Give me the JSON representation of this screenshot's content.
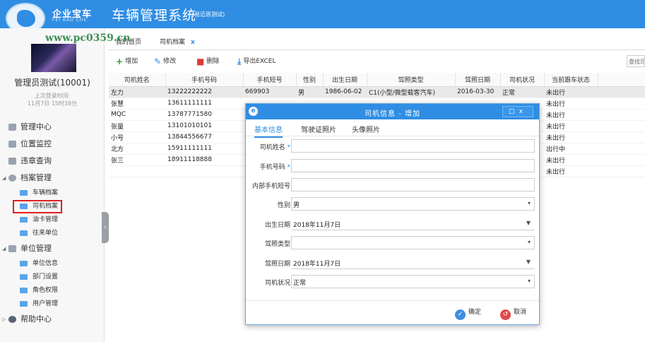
{
  "brand": {
    "name": "企业宝车",
    "sub": "FEI BAO CHE"
  },
  "app": {
    "title": "车辆管理系统",
    "subtitle": "(易迈思测试)"
  },
  "watermark": "www.pc0359.cn",
  "user": {
    "name": "管理员测试(10001)",
    "last_login_label": "上次登录时间:",
    "last_login_value": "11月7日 15时38分"
  },
  "nav": {
    "items": [
      {
        "label": "管理中心"
      },
      {
        "label": "位置监控"
      },
      {
        "label": "违章查询"
      }
    ],
    "archive": {
      "label": "档案管理",
      "children": [
        {
          "label": "车辆档案"
        },
        {
          "label": "司机档案"
        },
        {
          "label": "油卡管理"
        },
        {
          "label": "往来单位"
        }
      ]
    },
    "unit": {
      "label": "单位管理",
      "children": [
        {
          "label": "单位信息"
        },
        {
          "label": "部门设置"
        },
        {
          "label": "角色权限"
        },
        {
          "label": "用户管理"
        }
      ]
    },
    "help": {
      "label": "帮助中心"
    }
  },
  "tabs": {
    "home": "我的首页",
    "active": "司机档案",
    "close": "x"
  },
  "toolbar": {
    "add": "增加",
    "edit": "修改",
    "delete": "删除",
    "export": "导出EXCEL",
    "search": "查找司"
  },
  "grid": {
    "headers": [
      "司机姓名",
      "手机号码",
      "手机短号",
      "性别",
      "出生日期",
      "驾照类型",
      "驾照日期",
      "司机状况",
      "当前跟车状态"
    ],
    "rows": [
      [
        "左力",
        "13222222222",
        "669903",
        "男",
        "1986-06-02",
        "C1(小型/微型载客汽车)",
        "2016-03-30",
        "正常",
        "未出行"
      ],
      [
        "张慧",
        "13611111111",
        "",
        "",
        "",
        "",
        "",
        "",
        "未出行"
      ],
      [
        "MQC",
        "13787771580",
        "",
        "",
        "",
        "",
        "",
        "",
        "未出行"
      ],
      [
        "张量",
        "13101010101",
        "",
        "",
        "",
        "",
        "",
        "",
        "未出行"
      ],
      [
        "小号",
        "13844556677",
        "",
        "",
        "",
        "",
        "",
        "",
        "未出行"
      ],
      [
        "北方",
        "15911111111",
        "",
        "",
        "",
        "",
        "",
        "",
        "出行中"
      ],
      [
        "张三",
        "18911118888",
        "",
        "",
        "",
        "",
        "",
        "",
        "未出行"
      ],
      [
        "",
        "",
        "",
        "",
        "",
        "",
        "",
        "",
        "未出行"
      ]
    ]
  },
  "dialog": {
    "title": "司机信息 - 增加",
    "tabs": [
      "基本信息",
      "驾驶证照片",
      "头像照片"
    ],
    "fields": {
      "name": {
        "label": "司机姓名",
        "value": ""
      },
      "phone": {
        "label": "手机号码",
        "value": ""
      },
      "short": {
        "label": "内部手机短号",
        "value": ""
      },
      "gender": {
        "label": "性别",
        "value": "男"
      },
      "birth": {
        "label": "出生日期",
        "value": "2018年11月7日"
      },
      "license_type": {
        "label": "驾照类型",
        "value": ""
      },
      "license_date": {
        "label": "驾照日期",
        "value": "2018年11月7日"
      },
      "status": {
        "label": "司机状况",
        "value": "正常"
      }
    },
    "required_mark": "*",
    "ok": "确定",
    "cancel": "取消"
  }
}
